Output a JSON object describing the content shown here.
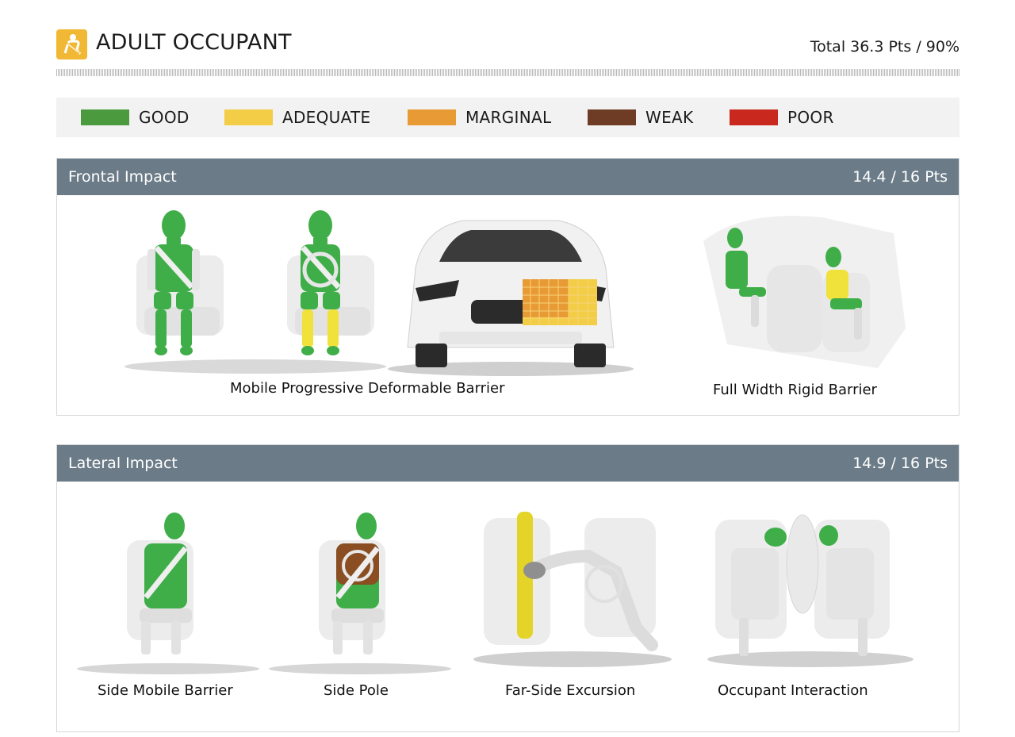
{
  "header": {
    "icon": "seatbelt-occupant-icon",
    "title": "ADULT OCCUPANT",
    "total": "Total 36.3 Pts / 90%"
  },
  "legend": [
    {
      "label": "GOOD",
      "color": "#4c9a3e"
    },
    {
      "label": "ADEQUATE",
      "color": "#f2cd45"
    },
    {
      "label": "MARGINAL",
      "color": "#e89a34"
    },
    {
      "label": "WEAK",
      "color": "#6e3c24"
    },
    {
      "label": "POOR",
      "color": "#c8281e"
    }
  ],
  "frontal": {
    "title": "Frontal Impact",
    "points": "14.4 / 16 Pts",
    "tests": [
      {
        "label": "Mobile Progressive Deformable Barrier"
      },
      {
        "label": "Full Width Rigid Barrier"
      }
    ]
  },
  "lateral": {
    "title": "Lateral Impact",
    "points": "14.9 / 16 Pts",
    "tests": [
      {
        "label": "Side Mobile Barrier"
      },
      {
        "label": "Side Pole"
      },
      {
        "label": "Far-Side Excursion"
      },
      {
        "label": "Occupant Interaction"
      }
    ]
  }
}
